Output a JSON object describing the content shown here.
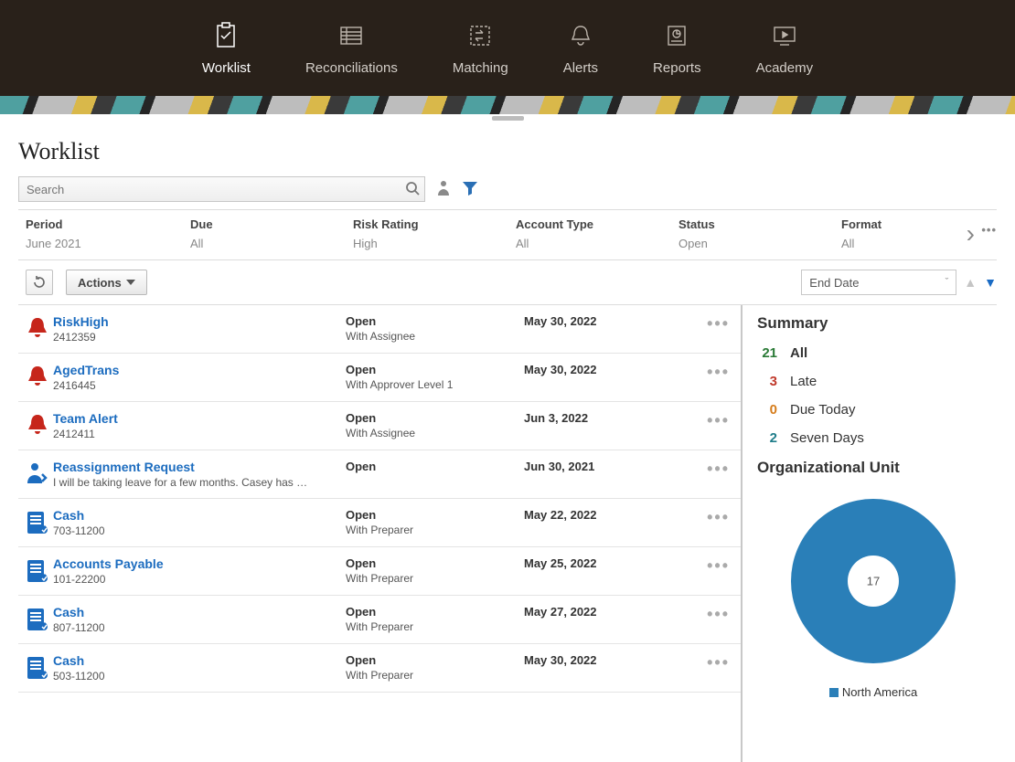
{
  "nav": {
    "worklist": "Worklist",
    "reconciliations": "Reconciliations",
    "matching": "Matching",
    "alerts": "Alerts",
    "reports": "Reports",
    "academy": "Academy"
  },
  "page_title": "Worklist",
  "search": {
    "placeholder": "Search"
  },
  "filters": {
    "period": {
      "label": "Period",
      "value": "June 2021"
    },
    "due": {
      "label": "Due",
      "value": "All"
    },
    "risk_rating": {
      "label": "Risk Rating",
      "value": "High"
    },
    "account_type": {
      "label": "Account Type",
      "value": "All"
    },
    "status": {
      "label": "Status",
      "value": "Open"
    },
    "format": {
      "label": "Format",
      "value": "All"
    }
  },
  "actions_button": "Actions",
  "sort_select": "End Date",
  "rows": [
    {
      "icon": "bell",
      "title": "RiskHigh",
      "sub": "2412359",
      "status": "Open",
      "status2": "With Assignee",
      "date": "May 30, 2022"
    },
    {
      "icon": "bell",
      "title": "AgedTrans",
      "sub": "2416445",
      "status": "Open",
      "status2": "With Approver Level 1",
      "date": "May 30, 2022"
    },
    {
      "icon": "bell",
      "title": "Team Alert",
      "sub": "2412411",
      "status": "Open",
      "status2": "With Assignee",
      "date": "Jun 3, 2022"
    },
    {
      "icon": "person",
      "title": "Reassignment Request",
      "sub": "I will be taking leave for a few months. Casey has …",
      "status": "Open",
      "status2": "",
      "date": "Jun 30, 2021"
    },
    {
      "icon": "doc",
      "title": "Cash",
      "sub": "703-11200",
      "status": "Open",
      "status2": "With Preparer",
      "date": "May 22, 2022"
    },
    {
      "icon": "doc",
      "title": "Accounts Payable",
      "sub": "101-22200",
      "status": "Open",
      "status2": "With Preparer",
      "date": "May 25, 2022"
    },
    {
      "icon": "doc",
      "title": "Cash",
      "sub": "807-11200",
      "status": "Open",
      "status2": "With Preparer",
      "date": "May 27, 2022"
    },
    {
      "icon": "doc",
      "title": "Cash",
      "sub": "503-11200",
      "status": "Open",
      "status2": "With Preparer",
      "date": "May 30, 2022"
    }
  ],
  "summary": {
    "title": "Summary",
    "all": {
      "num": "21",
      "label": "All"
    },
    "late": {
      "num": "3",
      "label": "Late"
    },
    "due_today": {
      "num": "0",
      "label": "Due Today"
    },
    "seven_days": {
      "num": "2",
      "label": "Seven Days"
    }
  },
  "org_unit": {
    "title": "Organizational Unit",
    "center_value": "17",
    "legend_label": "North America"
  },
  "chart_data": {
    "type": "pie",
    "title": "Organizational Unit",
    "series": [
      {
        "name": "North America",
        "value": 17,
        "color": "#2a7fb8"
      }
    ],
    "center_label": "17",
    "donut": true
  }
}
